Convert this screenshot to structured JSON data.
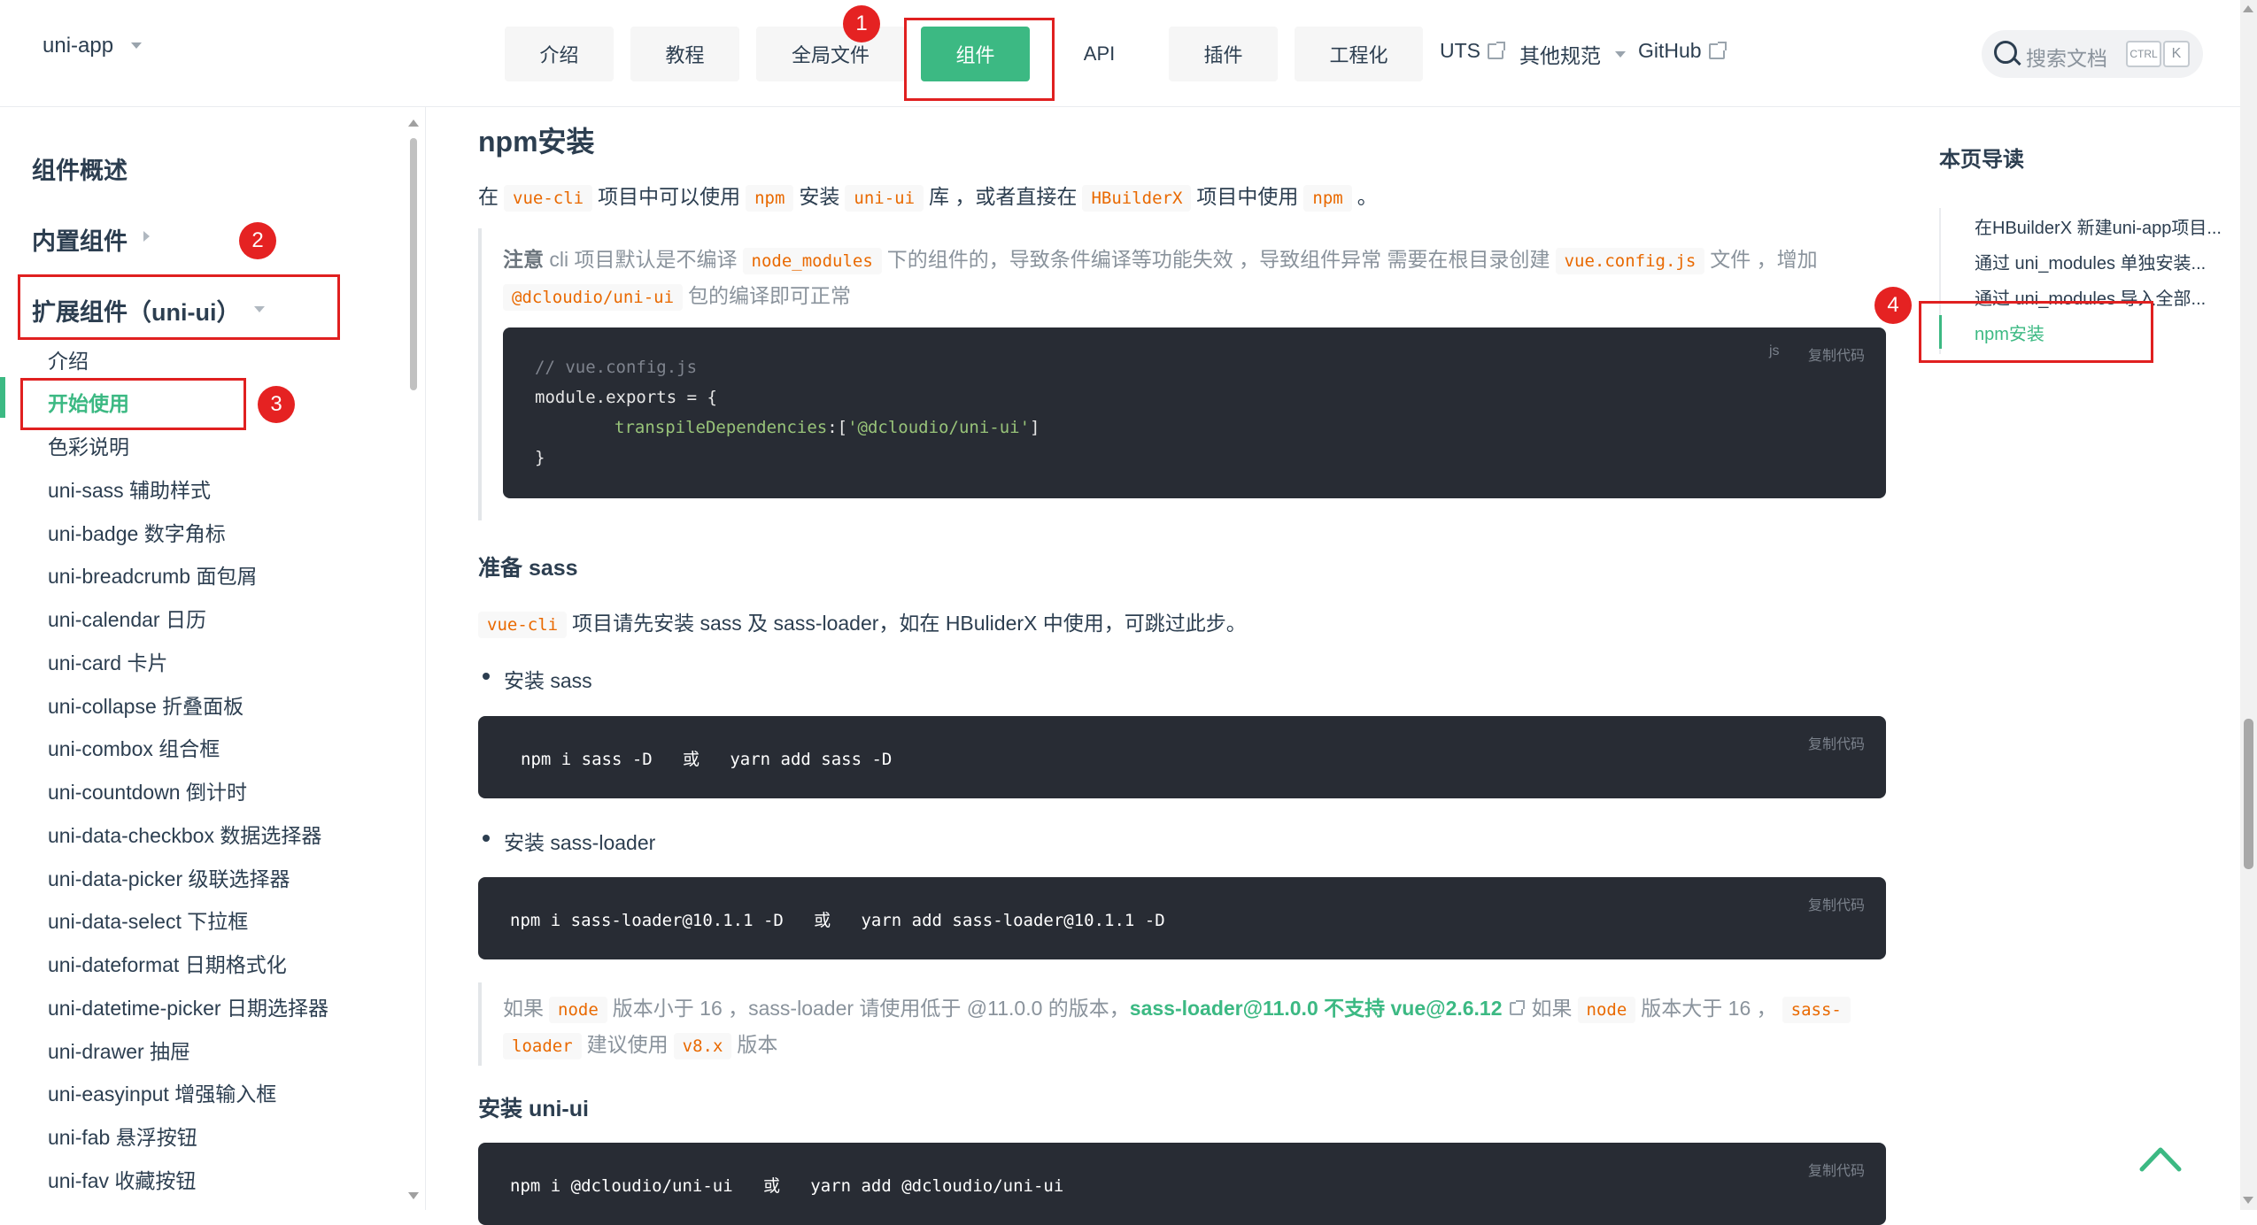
{
  "header": {
    "logo": "uni-app",
    "nav": [
      "介绍",
      "教程",
      "全局文件",
      "组件",
      "API",
      "插件",
      "工程化"
    ],
    "links": [
      "UTS",
      "其他规范",
      "GitHub"
    ],
    "search_placeholder": "搜索文档",
    "kbd_ctrl": "CTRL",
    "kbd_k": "K",
    "accent": "#3cb983"
  },
  "annotations": [
    "1",
    "2",
    "3",
    "4"
  ],
  "sidebar": {
    "groups": [
      "组件概述",
      "内置组件",
      "扩展组件（uni-ui）"
    ],
    "items": [
      "介绍",
      "开始使用",
      "色彩说明",
      "uni-sass 辅助样式",
      "uni-badge 数字角标",
      "uni-breadcrumb 面包屑",
      "uni-calendar 日历",
      "uni-card 卡片",
      "uni-collapse 折叠面板",
      "uni-combox 组合框",
      "uni-countdown 倒计时",
      "uni-data-checkbox 数据选择器",
      "uni-data-picker 级联选择器",
      "uni-data-select 下拉框",
      "uni-dateformat 日期格式化",
      "uni-datetime-picker 日期选择器",
      "uni-drawer 抽屉",
      "uni-easyinput 增强输入框",
      "uni-fab 悬浮按钮",
      "uni-fav 收藏按钮"
    ],
    "active_item": "开始使用"
  },
  "main": {
    "h_npm": "npm安装",
    "p1": {
      "t1": "在",
      "c1": "vue-cli",
      "t2": "项目中可以使用",
      "c2": "npm",
      "t3": "安装",
      "c3": "uni-ui",
      "t4": "库 ，或者直接在",
      "c4": "HBuilderX",
      "t5": "项目中使用",
      "c5": "npm",
      "t6": "。"
    },
    "tip1": {
      "label": "注意",
      "t1": " cli 项目默认是不编译",
      "c1": "node_modules",
      "t2": "下的组件的，导致条件编译等功能失效 ，导致组件异常 需要在根目录创建",
      "c2": "vue.config.js",
      "t3": "文件 ，增加",
      "c3": "@dcloudio/uni-ui",
      "t4": "包的编译即可正常"
    },
    "code1": {
      "lang": "js",
      "copy": "复制代码",
      "l1": "// vue.config.js",
      "l2a": "module.exports",
      "l2b": " = {",
      "l3a": "transpileDependencies",
      "l3b": ":[",
      "l3c": "'@dcloudio/uni-ui'",
      "l3d": "]",
      "l4": "}"
    },
    "h_sass": "准备 sass",
    "p_sass": {
      "c1": "vue-cli",
      "t1": "项目请先安装 sass 及 sass-loader，如在 HBuliderX 中使用，可跳过此步。"
    },
    "bullet1": "安装 sass",
    "code2": {
      "copy": "复制代码",
      "cmd": "npm i sass -D   或   yarn add sass -D"
    },
    "bullet2": "安装 sass-loader",
    "code3": {
      "copy": "复制代码",
      "cmd": "npm i sass-loader@10.1.1 -D   或   yarn add sass-loader@10.1.1 -D"
    },
    "tip2": {
      "t1": "如果",
      "c1": "node",
      "t2": "版本小于 16 ，sass-loader 请使用低于 @11.0.0 的版本，",
      "link": "sass-loader@11.0.0 不支持 vue@2.6.12",
      "t3": "如果",
      "c2": "node",
      "t4": "版本大于 16 ，",
      "c3a": "sass-",
      "c3b": "loader",
      "t5": "建议使用",
      "c4": "v8.x",
      "t6": "版本"
    },
    "h_uniui": "安装 uni-ui",
    "code4": {
      "copy": "复制代码",
      "cmd": "npm i @dcloudio/uni-ui   或   yarn add @dcloudio/uni-ui"
    }
  },
  "toc": {
    "title": "本页导读",
    "items": [
      "在HBuilderX 新建uni-app项目...",
      "通过 uni_modules 单独安装...",
      "通过 uni_modules 导入全部...",
      "npm安装"
    ],
    "active": "npm安装"
  }
}
